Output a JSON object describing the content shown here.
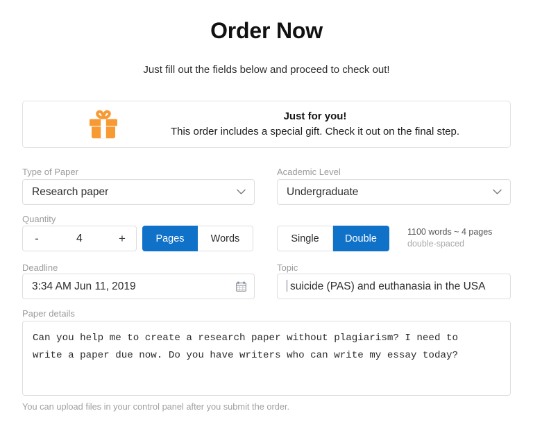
{
  "header": {
    "title": "Order Now",
    "subtitle": "Just fill out the fields below and proceed to check out!"
  },
  "gift_banner": {
    "icon": "gift-icon",
    "title": "Just for you!",
    "description": "This order includes a special gift. Check it out on the final step."
  },
  "form": {
    "type_of_paper": {
      "label": "Type of Paper",
      "value": "Research paper",
      "icon": "chevron-down-icon"
    },
    "academic_level": {
      "label": "Academic Level",
      "value": "Undergraduate",
      "icon": "chevron-down-icon"
    },
    "quantity": {
      "label": "Quantity",
      "decrement": "-",
      "value": "4",
      "increment": "+"
    },
    "units_toggle": {
      "options": [
        "Pages",
        "Words"
      ],
      "selected": "Pages"
    },
    "spacing_toggle": {
      "options": [
        "Single",
        "Double"
      ],
      "selected": "Double"
    },
    "words_note": {
      "line1": "1100 words ~ 4 pages",
      "line2": "double-spaced"
    },
    "deadline": {
      "label": "Deadline",
      "value": "3:34 AM Jun 11, 2019",
      "icon": "calendar-icon"
    },
    "topic": {
      "label": "Topic",
      "value": "suicide (PAS) and euthanasia in the USA",
      "placeholder": "Topic"
    },
    "paper_details": {
      "label": "Paper details",
      "value": "Can you help me to create a research paper without plagiarism? I need to\nwrite a paper due now. Do you have writers who can write my essay today?",
      "placeholder": "Paper details"
    },
    "upload_note": "You can upload files in your control panel after you submit the order."
  },
  "colors": {
    "accent_blue": "#1071c9",
    "gift_orange": "#f79a34",
    "label_gray": "#9b9b9b",
    "border_gray": "#dedede"
  }
}
